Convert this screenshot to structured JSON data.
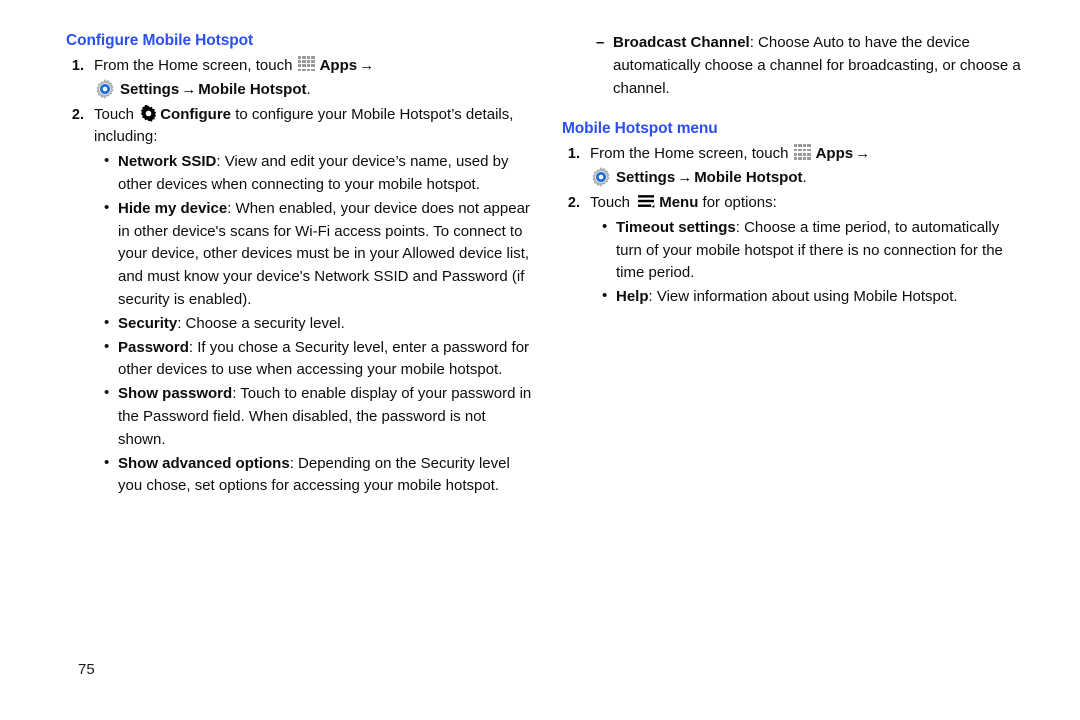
{
  "page": {
    "number": "75"
  },
  "icons": {
    "apps": "apps-grid-icon",
    "settings": "settings-gear-icon",
    "configure": "configure-gear-icon",
    "menu": "menu-hamburger-icon",
    "arrow": "→"
  },
  "left_column": {
    "heading": "Configure Mobile Hotspot",
    "steps": [
      {
        "number": "1.",
        "line1_before_icon": "From the Home screen, touch ",
        "apps_label": "Apps",
        "settings_label": "Settings",
        "settings_target": "Mobile Hotspot",
        "settings_period": "."
      },
      {
        "number": "2.",
        "text_before": "Touch ",
        "configure_label": "Configure",
        "text_after": " to configure your Mobile Hotspot’s details, including:"
      }
    ],
    "bullets": [
      {
        "term": "Network SSID",
        "desc": ": View and edit your device’s name, used by other devices when connecting to your mobile hotspot."
      },
      {
        "term": "Hide my device",
        "desc": ": When enabled, your device does not appear in other device's scans for Wi-Fi access points. To connect to your device, other devices must be in your Allowed device list, and must know your device's Network SSID and Password (if security is enabled)."
      },
      {
        "term": "Security",
        "desc": ": Choose a security level."
      },
      {
        "term": "Password",
        "desc": ": If you chose a Security level, enter a password for other devices to use when accessing your mobile hotspot."
      },
      {
        "term": "Show password",
        "desc": ": Touch to enable display of your password in the Password field. When disabled, the password is not shown."
      },
      {
        "term": "Show advanced options",
        "desc": ": Depending on the Security level you chose, set options for accessing your mobile hotspot."
      }
    ]
  },
  "right_column": {
    "continued_bullet": {
      "term": "Broadcast Channel",
      "desc": ": Choose Auto to have the device automatically choose a channel for broadcasting, or choose a channel."
    },
    "heading": "Mobile Hotspot menu",
    "steps": [
      {
        "number": "1.",
        "line1_before_icon": "From the Home screen, touch ",
        "apps_label": "Apps",
        "settings_label": "Settings",
        "settings_target": "Mobile Hotspot",
        "settings_period": "."
      },
      {
        "number": "2.",
        "text_before": "Touch ",
        "menu_label": "Menu",
        "text_after": " for options:"
      }
    ],
    "bullets": [
      {
        "term": "Timeout settings",
        "desc": ": Choose a time period, to automatically turn of your mobile hotspot if there is no connection for the time period."
      },
      {
        "term": "Help",
        "desc": ": View information about using Mobile Hotspot."
      }
    ]
  },
  "colors": {
    "heading_blue": "#2b4ff0",
    "text_black": "#0d0d0d",
    "icon_gray": "#9a9a9a",
    "icon_blue": "#1f6fe0"
  }
}
